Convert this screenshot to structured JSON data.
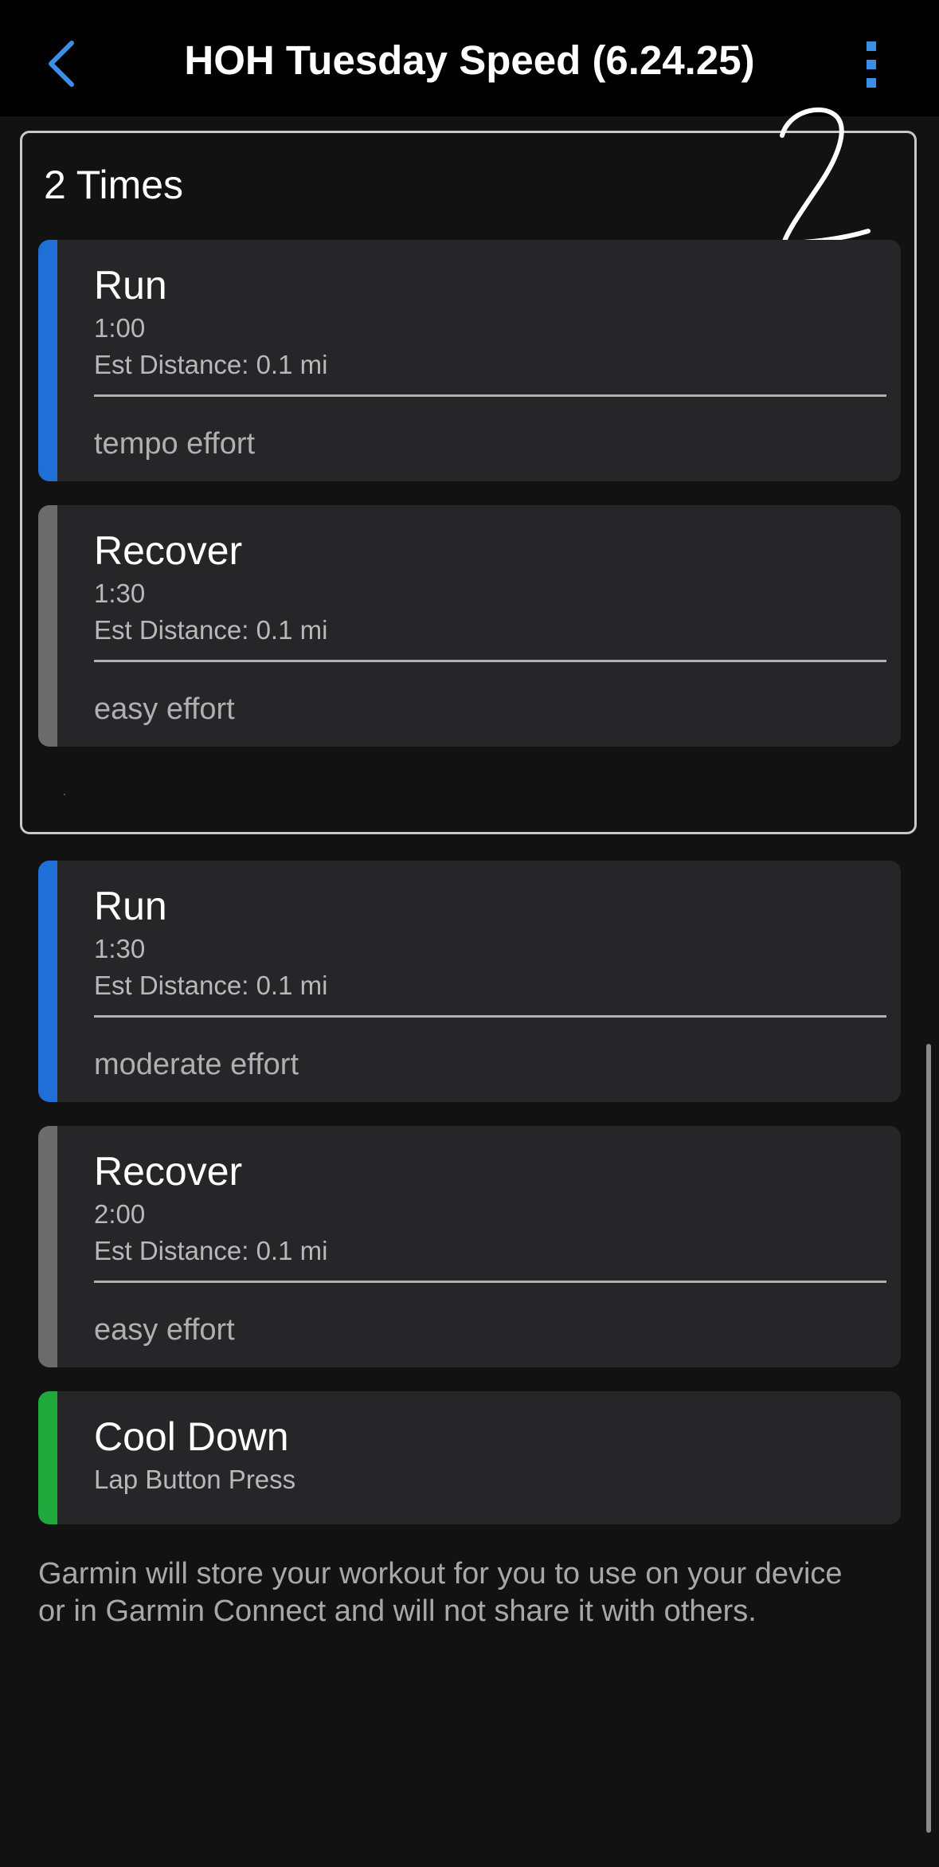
{
  "header": {
    "title": "HOH Tuesday Speed (6.24.25)"
  },
  "annotation": {
    "handwritten": "2"
  },
  "repeat_block": {
    "label": "2 Times",
    "steps": [
      {
        "title": "Run",
        "duration": "1:00",
        "distance": "Est Distance: 0.1 mi",
        "note": "tempo effort",
        "color": "#1f6fd6"
      },
      {
        "title": "Recover",
        "duration": "1:30",
        "distance": "Est Distance: 0.1 mi",
        "note": "easy effort",
        "color": "#6b6b6b"
      }
    ]
  },
  "steps": [
    {
      "title": "Run",
      "duration": "1:30",
      "distance": "Est Distance: 0.1 mi",
      "note": "moderate effort",
      "color": "#1f6fd6"
    },
    {
      "title": "Recover",
      "duration": "2:00",
      "distance": "Est Distance: 0.1 mi",
      "note": "easy effort",
      "color": "#6b6b6b"
    }
  ],
  "cooldown": {
    "title": "Cool Down",
    "subtitle": "Lap Button Press",
    "color": "#1fa83c"
  },
  "footer": {
    "text": "Garmin will store your workout for you to use on your device or in Garmin Connect and will not share it with others."
  },
  "colors": {
    "accent": "#3b8fe6",
    "background": "#121212",
    "card": "#262628"
  },
  "icons": {
    "back": "chevron-left-icon",
    "menu": "more-vertical-icon"
  }
}
